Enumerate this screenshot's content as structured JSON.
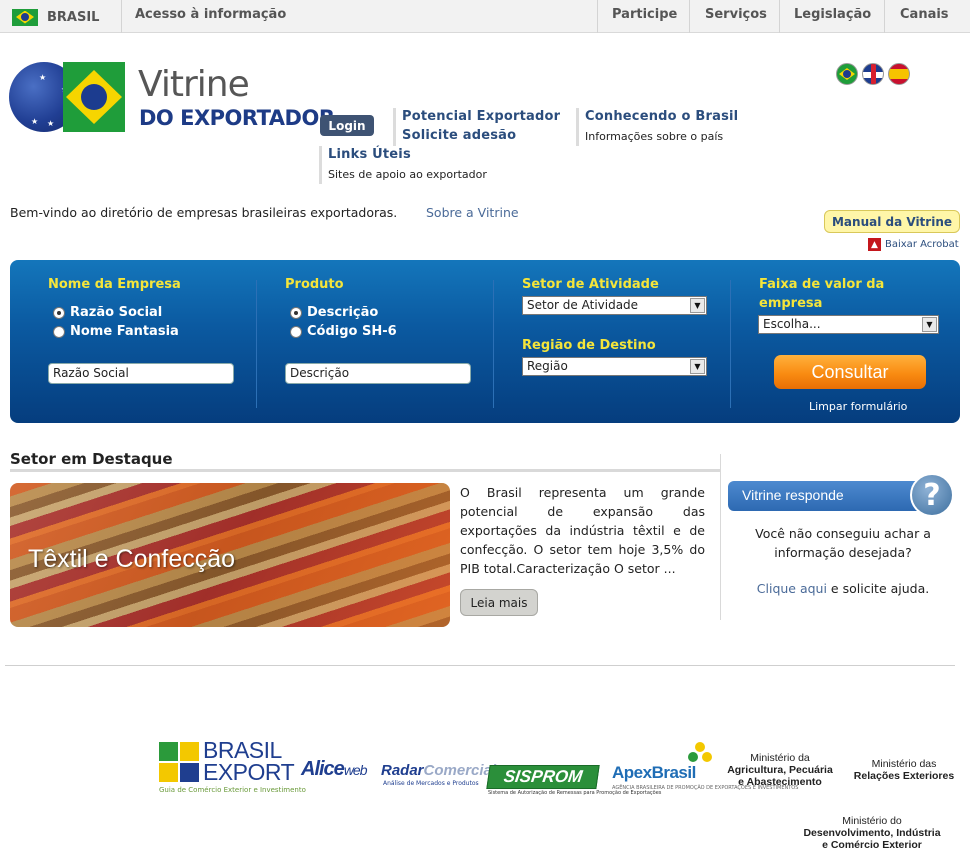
{
  "govbar": {
    "country": "BRASIL",
    "access": "Acesso à informação",
    "links": [
      "Participe",
      "Serviços",
      "Legislação",
      "Canais"
    ]
  },
  "header": {
    "logo_line1": "Vitrine",
    "logo_line2": "DO EXPORTADOR",
    "login": "Login",
    "nav": {
      "potencial": "Potencial Exportador",
      "solicite": "Solicite adesão",
      "conhecendo": "Conhecendo o Brasil",
      "conhecendo_sub": "Informações sobre o país",
      "links_uteis": "Links Úteis",
      "links_uteis_sub": "Sites de apoio ao exportador"
    },
    "languages": [
      "pt",
      "en",
      "es"
    ]
  },
  "intro": {
    "welcome": "Bem-vindo ao diretório de empresas brasileiras exportadoras.",
    "sobre": "Sobre a Vitrine",
    "manual": "Manual da Vitrine",
    "acrobat": "Baixar Acrobat"
  },
  "search": {
    "empresa_label": "Nome da Empresa",
    "empresa_options": [
      "Razão Social",
      "Nome Fantasia"
    ],
    "empresa_selected": 0,
    "empresa_input": "Razão Social",
    "produto_label": "Produto",
    "produto_options": [
      "Descrição",
      "Código SH-6"
    ],
    "produto_selected": 0,
    "produto_input": "Descrição",
    "setor_label": "Setor de Atividade",
    "setor_value": "Setor de Atividade",
    "regiao_label": "Região de Destino",
    "regiao_value": "Região",
    "faixa_label": "Faixa de valor da empresa",
    "faixa_value": "Escolha...",
    "consultar": "Consultar",
    "limpar": "Limpar formulário"
  },
  "destaque": {
    "title": "Setor em Destaque",
    "image_label": "Têxtil e Confecção",
    "description": "O Brasil representa um grande potencial de expansão das exportações da indústria têxtil e de confecção. O setor tem hoje 3,5% do PIB total.Caracterização O setor ...",
    "leia_mais": "Leia mais"
  },
  "responde": {
    "title": "Vitrine responde",
    "message": "Você não conseguiu achar a informação desejada?",
    "link": "Clique aqui",
    "after_link": " e solicite ajuda."
  },
  "footer": {
    "brasil_export_1": "BRASIL",
    "brasil_export_2": "EXPORT",
    "brasil_export_sub": "Guia de Comércio Exterior e Investimento",
    "alice": "Alice",
    "alice_web": "web",
    "radar_1": "Radar",
    "radar_2": "Comercial",
    "radar_sub": "Análise de Mercados e Produtos",
    "sisprom": "SISPROM",
    "sisprom_sub": "Sistema de Autorização de Remessas para Promoção de Exportações",
    "apex": "ApexBrasil",
    "apex_sub": "AGÊNCIA BRASILEIRA DE PROMOÇÃO DE EXPORTAÇÕES E INVESTIMENTOS",
    "min_agri_1": "Ministério da",
    "min_agri_2": "Agricultura, Pecuária",
    "min_agri_3": "e Abastecimento",
    "min_rel_1": "Ministério das",
    "min_rel_2": "Relações Exteriores",
    "min_desenv_1": "Ministério do",
    "min_desenv_2": "Desenvolvimento, Indústria",
    "min_desenv_3": "e Comércio Exterior"
  }
}
